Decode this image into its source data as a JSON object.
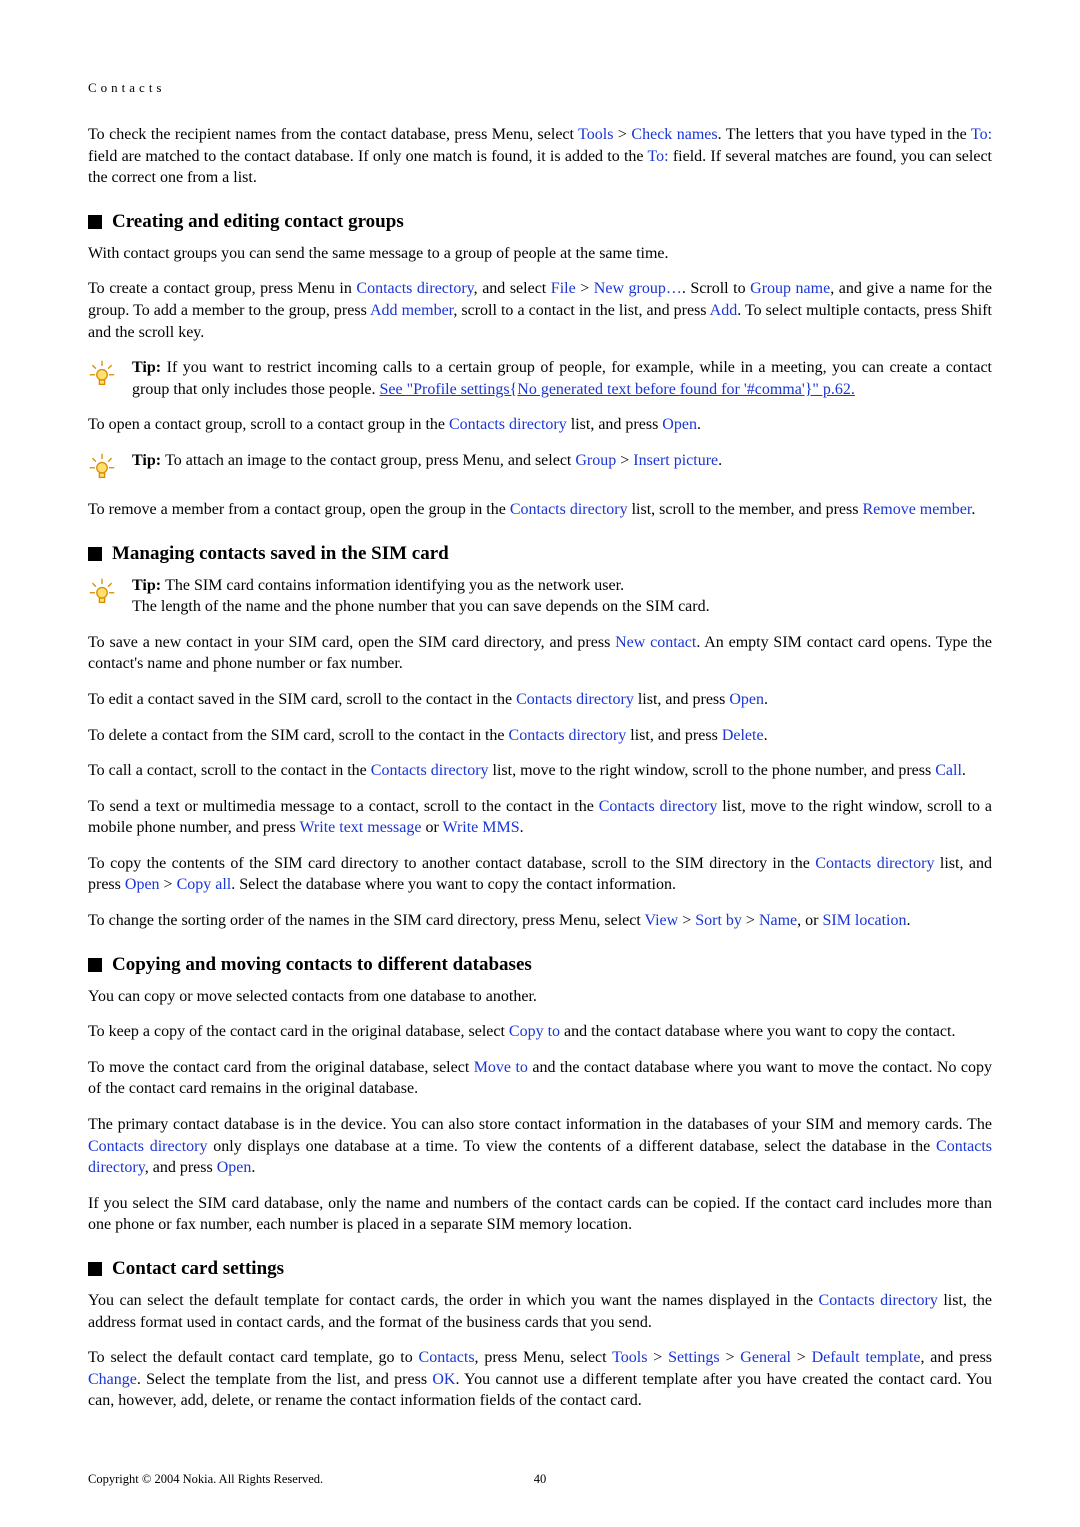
{
  "header": "Contacts",
  "intro": {
    "pre1": "To check the recipient names from the contact database, press Menu, select ",
    "tools": "Tools",
    "gt1": " > ",
    "check": "Check names",
    "pre2": ". The letters that you have typed in the ",
    "to1": "To:",
    "mid1": " field are matched to the contact database. If only one match is found, it is added to the ",
    "to2": "To:",
    "post": " field. If several matches are found, you can select the correct one from a list."
  },
  "sec1": {
    "title": "Creating and editing contact groups",
    "p1": "With contact groups you can send the same message to a group of people at the same time.",
    "p2a": "To create a contact group, press Menu in ",
    "link_cd1": "Contacts directory",
    "p2b": ", and select ",
    "file": "File",
    "gt": " > ",
    "newgroup": "New group…",
    "p2c": ". Scroll to ",
    "groupname": "Group name",
    "p2d": ", and give a name for the group. To add a member to the group, press ",
    "addmember": "Add member",
    "p2e": ", scroll to a contact in the list, and press ",
    "add": "Add",
    "p2f": ". To select multiple contacts, press Shift and the scroll key.",
    "tip1a": "Tip: ",
    "tip1b": "If you want to restrict incoming calls to a certain group of people, for example, while in a meeting, you can create a contact group that only includes those people. ",
    "tip1link": "See \"Profile settings{No generated text before found for '#comma'}\" p.62.",
    "p3a": "To open a contact group, scroll to a contact group in the ",
    "link_cd2": "Contacts directory",
    "p3b": " list, and press ",
    "open1": "Open",
    "p3c": ".",
    "tip2a": "Tip: ",
    "tip2b": "To attach an image to the contact group, press Menu, and select ",
    "group": "Group",
    "insertpic": "Insert picture",
    "p4a": "To remove a member from a contact group, open the group in the ",
    "link_cd3": "Contacts directory",
    "p4b": " list, scroll to the member, and press ",
    "removemember": "Remove member",
    "p4c": "."
  },
  "sec2": {
    "title": "Managing contacts saved in the SIM card",
    "tip1a": "Tip: ",
    "tip1b": "The SIM card contains information identifying you as the network user.",
    "tip1c": "The length of the name and the phone number that you can save depends on the SIM card.",
    "p1a": "To save a new contact in your SIM card, open the SIM card directory, and press ",
    "newcontact": "New contact",
    "p1b": ". An empty SIM contact card opens. Type the contact's name and phone number or fax number.",
    "p2a": "To edit a contact saved in the SIM card, scroll to the contact in the ",
    "cd1": "Contacts directory",
    "p2b": " list, and press ",
    "open": "Open",
    "p3a": "To delete a contact from the SIM card, scroll to the contact in the ",
    "cd2": "Contacts directory",
    "p3b": " list, and press ",
    "delete": "Delete",
    "p4a": "To call a contact, scroll to the contact in the ",
    "cd3": "Contacts directory",
    "p4b": " list, move to the right window, scroll to the phone number, and press ",
    "call": "Call",
    "p5a": "To send a text or multimedia message to a contact, scroll to the contact in the ",
    "cd4": "Contacts directory",
    "p5b": " list, move to the right window, scroll to a mobile phone number, and press ",
    "wtm": "Write text message",
    "or": " or ",
    "wmms": "Write MMS",
    "p6a": "To copy the contents of the SIM card directory to another contact database, scroll to the SIM directory in the ",
    "cd5": "Contacts directory",
    "p6b": " list, and press ",
    "open2": "Open",
    "gt": " > ",
    "copyall": "Copy all",
    "p6c": ". Select the database where you want to copy the contact information.",
    "p7a": "To change the sorting order of the names in the SIM card directory, press Menu, select ",
    "view": "View",
    "sortby": "Sort by",
    "name": "Name",
    "p7b": ", or ",
    "simloc": "SIM location",
    "dot": "."
  },
  "sec3": {
    "title": "Copying and moving contacts to different databases",
    "p1": "You can copy or move selected contacts from one database to another.",
    "p2a": "To keep a copy of the contact card in the original database, select ",
    "copyto": "Copy to",
    "p2b": " and the contact database where you want to copy the contact.",
    "p3a": "To move the contact card from the original database, select ",
    "moveto": "Move to",
    "p3b": " and the contact database where you want to move the contact. No copy of the contact card remains in the original database.",
    "p4a": "The primary contact database is in the device. You can also store contact information in the databases of your SIM and memory cards. The ",
    "cd1": "Contacts directory",
    "p4b": " only displays one database at a time. To view the contents of a different database, select the database in the ",
    "cd2": "Contacts directory",
    "p4c": ", and press ",
    "open": "Open",
    "p5": "If you select the SIM card database, only the name and numbers of the contact cards can be copied. If the contact card includes more than one phone or fax number, each number is placed in a separate SIM memory location."
  },
  "sec4": {
    "title": "Contact card settings",
    "p1a": "You can select the default template for contact cards, the order in which you want the names displayed in the ",
    "cd1": "Contacts directory",
    "p1b": " list, the address format used in contact cards, and the format of the business cards that you send.",
    "p2a": "To select the default contact card template, go to ",
    "contacts": "Contacts",
    "p2b": ", press Menu, select ",
    "tools": "Tools",
    "gt": " > ",
    "settings": "Settings",
    "general": "General",
    "deftpl": "Default template",
    "p2c": ", and press ",
    "change": "Change",
    "p2d": ". Select the template from the list, and press ",
    "ok": "OK",
    "p2e": ". You cannot use a different template after you have created the contact card. You can, however, add, delete, or rename the contact information fields of the contact card."
  },
  "footer": {
    "copyright": "Copyright © 2004 Nokia. All Rights Reserved.",
    "page": "40"
  }
}
